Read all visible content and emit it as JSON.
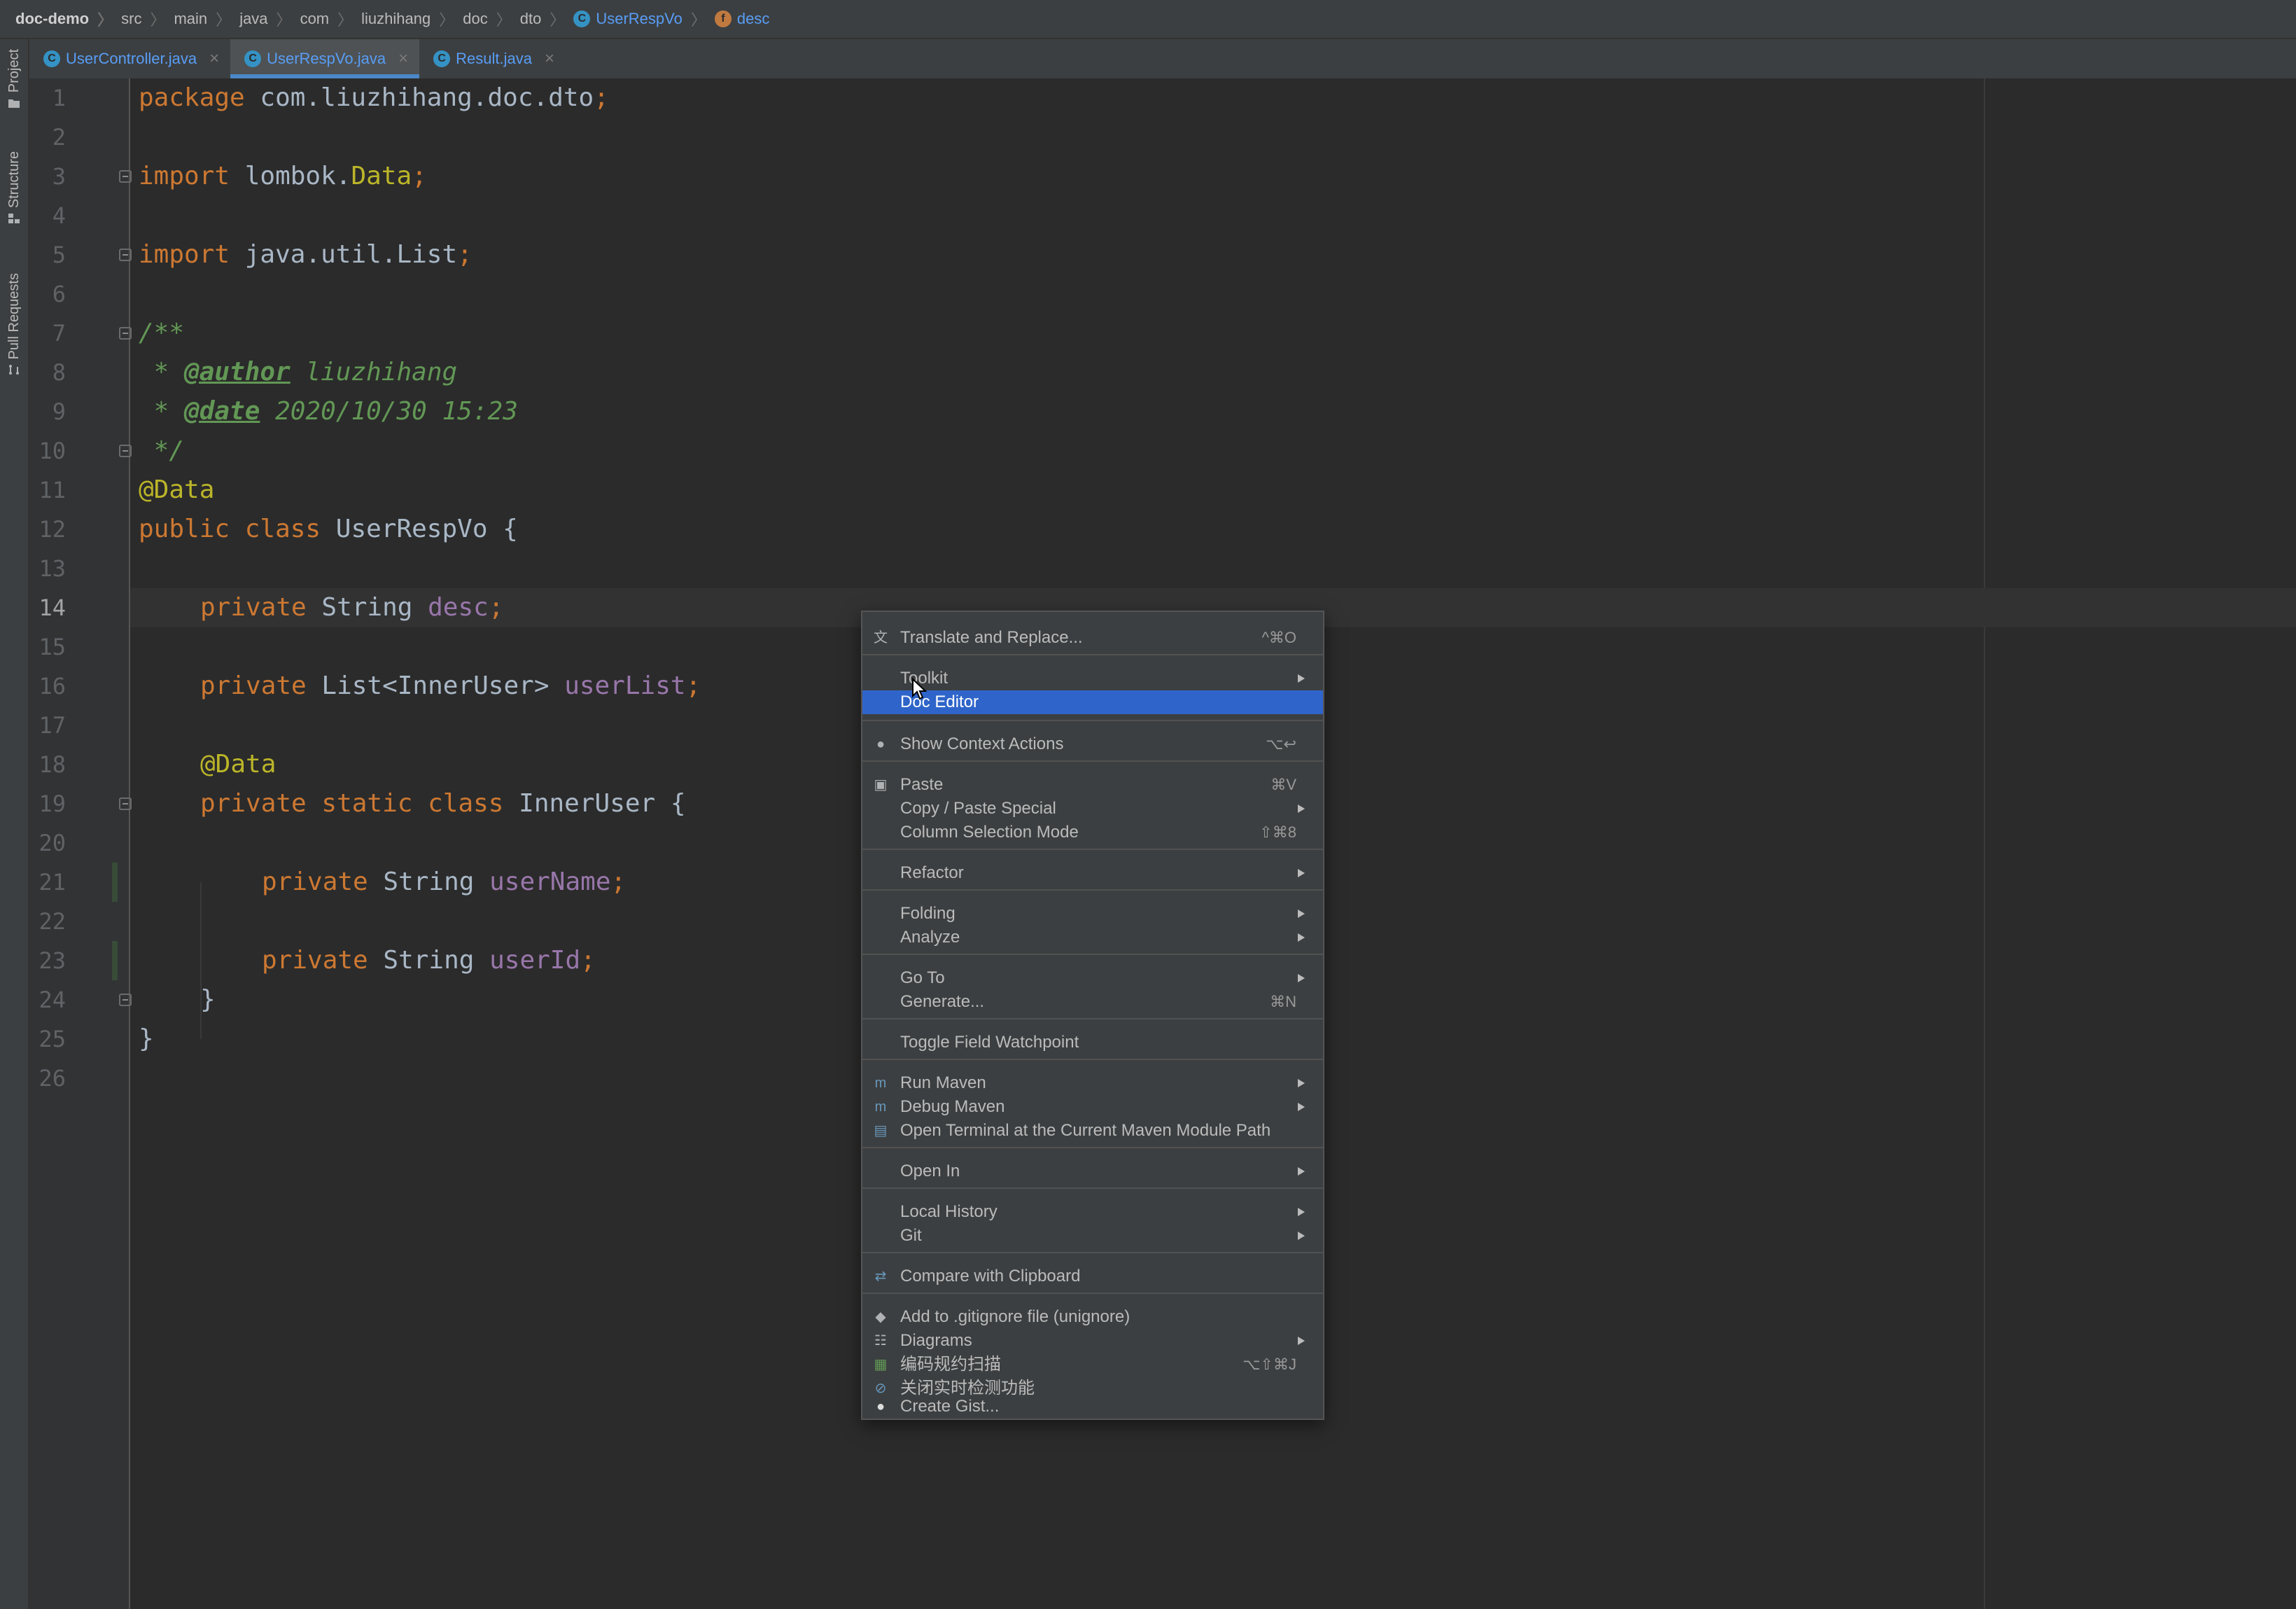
{
  "breadcrumb": {
    "project": "doc-demo",
    "parts": [
      "src",
      "main",
      "java",
      "com",
      "liuzhihang",
      "doc",
      "dto"
    ],
    "class_name": "UserRespVo",
    "member_name": "desc"
  },
  "tool_windows": [
    "Project",
    "Structure",
    "Pull Requests"
  ],
  "tabs": [
    {
      "label": "UserController.java",
      "active": false
    },
    {
      "label": "UserRespVo.java",
      "active": true
    },
    {
      "label": "Result.java",
      "active": false
    }
  ],
  "editor": {
    "current_line": 14,
    "line_numbers": [
      "1",
      "2",
      "3",
      "4",
      "5",
      "6",
      "7",
      "8",
      "9",
      "10",
      "11",
      "12",
      "13",
      "14",
      "15",
      "16",
      "17",
      "18",
      "19",
      "20",
      "21",
      "22",
      "23",
      "24",
      "25",
      "26"
    ],
    "code": {
      "l1": {
        "kw": "package",
        "name": " com.liuzhihang.doc.dto",
        "end": ";"
      },
      "l3": {
        "kw": "import",
        "name": " lombok.",
        "ann": "Data",
        "end": ";"
      },
      "l5": {
        "kw": "import",
        "name": " java.util.List",
        "end": ";"
      },
      "l7": "/**",
      "l8": {
        "pre": " * ",
        "tag": "@author",
        "text": " liuzhihang"
      },
      "l9": {
        "pre": " * ",
        "tag": "@date",
        "text": " 2020/10/30 15:23"
      },
      "l10": " */",
      "l11": "@Data",
      "l12": {
        "kw": "public class",
        "name": " UserRespVo {"
      },
      "l14": {
        "kw": "private",
        "type": " String ",
        "field": "desc",
        "end": ";"
      },
      "l16": {
        "kw": "private",
        "type": " List<InnerUser> ",
        "field": "userList",
        "end": ";"
      },
      "l18": "@Data",
      "l19": {
        "kw": "private static class",
        "name": " InnerUser {"
      },
      "l21": {
        "kw": "private",
        "type": " String ",
        "field": "userName",
        "end": ";"
      },
      "l23": {
        "kw": "private",
        "type": " String ",
        "field": "userId",
        "end": ";"
      },
      "l24": "}",
      "l25": "}"
    }
  },
  "context_menu": {
    "items": [
      {
        "label": "Translate and Replace...",
        "shortcut": "^⌘O",
        "icon": "translate-icon"
      },
      {
        "label": "Toolkit",
        "submenu": true
      },
      {
        "label": "Doc Editor",
        "selected": true
      },
      {
        "label": "Show Context Actions",
        "shortcut": "⌥↩",
        "icon": "lightbulb-icon"
      },
      {
        "label": "Paste",
        "shortcut": "⌘V",
        "icon": "clipboard-icon"
      },
      {
        "label": "Copy / Paste Special",
        "submenu": true
      },
      {
        "label": "Column Selection Mode",
        "shortcut": "⇧⌘8"
      },
      {
        "label": "Refactor",
        "submenu": true
      },
      {
        "label": "Folding",
        "submenu": true
      },
      {
        "label": "Analyze",
        "submenu": true
      },
      {
        "label": "Go To",
        "submenu": true
      },
      {
        "label": "Generate...",
        "shortcut": "⌘N"
      },
      {
        "label": "Toggle Field Watchpoint"
      },
      {
        "label": "Run Maven",
        "submenu": true,
        "icon": "maven-run-icon"
      },
      {
        "label": "Debug Maven",
        "submenu": true,
        "icon": "maven-debug-icon"
      },
      {
        "label": "Open Terminal at the Current Maven Module Path",
        "icon": "maven-terminal-icon"
      },
      {
        "label": "Open In",
        "submenu": true
      },
      {
        "label": "Local History",
        "submenu": true
      },
      {
        "label": "Git",
        "submenu": true
      },
      {
        "label": "Compare with Clipboard",
        "icon": "compare-icon"
      },
      {
        "label": "Add to .gitignore file (unignore)",
        "icon": "gitignore-icon"
      },
      {
        "label": "Diagrams",
        "submenu": true,
        "icon": "diagram-icon"
      },
      {
        "label": "编码规约扫描",
        "shortcut": "⌥⇧⌘J",
        "icon": "scan-icon"
      },
      {
        "label": "关闭实时检测功能",
        "icon": "disable-icon"
      },
      {
        "label": "Create Gist...",
        "icon": "github-icon"
      }
    ]
  },
  "colors": {
    "background": "#2b2b2b",
    "keyword": "#cc7832",
    "annotation": "#bbb529",
    "doc_comment": "#629755",
    "field": "#9876aa",
    "selection": "#2f65ca"
  }
}
